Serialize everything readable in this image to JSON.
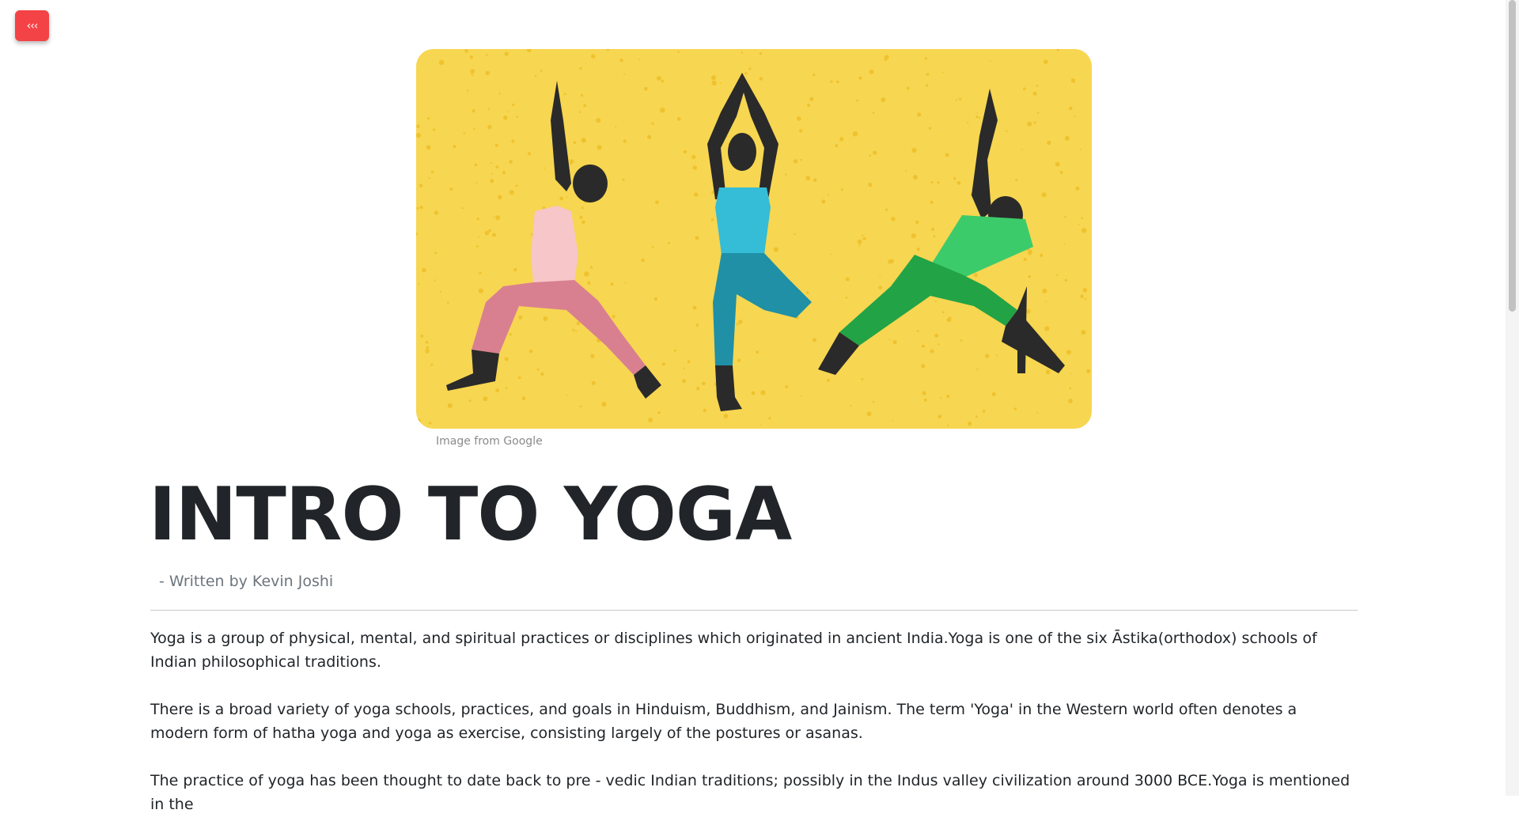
{
  "nav": {
    "back_label": "‹‹‹"
  },
  "hero": {
    "image_name": "yoga-poses-illustration",
    "caption": "Image from Google",
    "background_color": "#f7d651"
  },
  "article": {
    "title": "INTRO TO YOGA",
    "author": "- Written by Kevin Joshi",
    "paragraphs": [
      "Yoga is a group of physical, mental, and spiritual practices or disciplines which originated in ancient India.Yoga is one of the six Āstika(orthodox) schools of Indian philosophical traditions.",
      "There is a broad variety of yoga schools, practices, and goals in Hinduism, Buddhism, and Jainism. The term 'Yoga' in the Western world often denotes a modern form of hatha yoga and yoga as exercise, consisting largely of the postures or asanas.",
      "The practice of yoga has been thought to date back to pre - vedic Indian traditions; possibly in the Indus valley civilization around 3000 BCE.Yoga is mentioned in the"
    ]
  },
  "colors": {
    "accent": "#f44346",
    "text": "#212529",
    "muted": "#6c757d"
  }
}
